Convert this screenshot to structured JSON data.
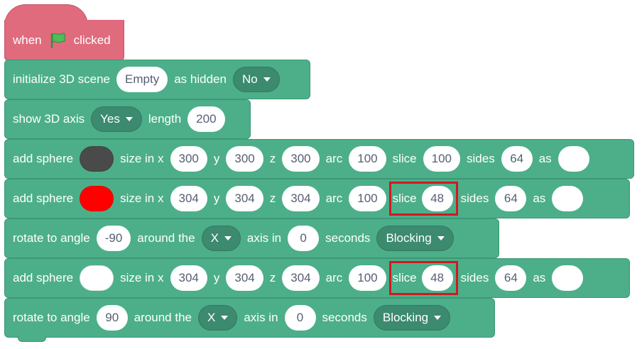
{
  "hat": {
    "when": "when",
    "clicked": "clicked"
  },
  "init": {
    "label": "initialize 3D scene",
    "scene": "Empty",
    "as_hidden": "as hidden",
    "hidden_value": "No"
  },
  "axis": {
    "label": "show 3D axis",
    "value": "Yes",
    "length_label": "length",
    "length": "200"
  },
  "sphere1": {
    "label": "add sphere",
    "color": "#4a4a4a",
    "size_x": "size in x",
    "x": "300",
    "y_label": "y",
    "y": "300",
    "z_label": "z",
    "z": "300",
    "arc_label": "arc",
    "arc": "100",
    "slice_label": "slice",
    "slice": "100",
    "sides_label": "sides",
    "sides": "64",
    "as_label": "as",
    "as_value": ""
  },
  "sphere2": {
    "label": "add sphere",
    "color": "#ff0000",
    "size_x": "size in x",
    "x": "304",
    "y_label": "y",
    "y": "304",
    "z_label": "z",
    "z": "304",
    "arc_label": "arc",
    "arc": "100",
    "slice_label": "slice",
    "slice": "48",
    "sides_label": "sides",
    "sides": "64",
    "as_label": "as",
    "as_value": ""
  },
  "rotate1": {
    "label": "rotate to angle",
    "angle": "-90",
    "around": "around the",
    "axis": "X",
    "axis_in": "axis in",
    "seconds_value": "0",
    "seconds": "seconds",
    "mode": "Blocking"
  },
  "sphere3": {
    "label": "add sphere",
    "color": "#ffffff",
    "size_x": "size in x",
    "x": "304",
    "y_label": "y",
    "y": "304",
    "z_label": "z",
    "z": "304",
    "arc_label": "arc",
    "arc": "100",
    "slice_label": "slice",
    "slice": "48",
    "sides_label": "sides",
    "sides": "64",
    "as_label": "as",
    "as_value": ""
  },
  "rotate2": {
    "label": "rotate to angle",
    "angle": "90",
    "around": "around the",
    "axis": "X",
    "axis_in": "axis in",
    "seconds_value": "0",
    "seconds": "seconds",
    "mode": "Blocking"
  },
  "colors": {
    "control_green": "#4caf8a",
    "event_hat": "#e06b7d",
    "highlight": "#d0191f",
    "flag": "#4cbf56"
  }
}
